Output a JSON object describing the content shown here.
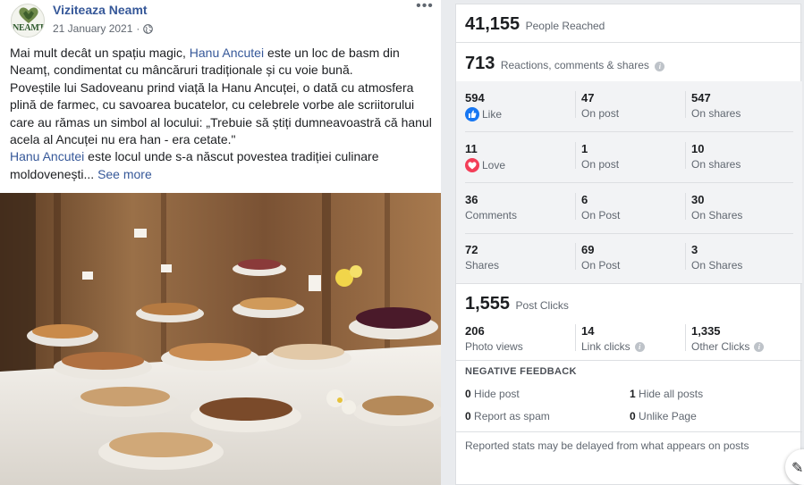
{
  "post": {
    "page_name": "Viziteaza Neamt",
    "avatar_text": "NEAMT",
    "date": "21 January 2021",
    "separator": "·",
    "text": {
      "line1_a": "Mai mult decât un spațiu magic, ",
      "line1_link": "Hanu Ancutei",
      "line1_b": " este un loc de basm din Neamț, condimentat cu mâncăruri tradiționale și cu voie bună.",
      "line2": "Poveștile lui Sadoveanu prind viață la Hanu Ancuței, o dată cu atmosfera plină de farmec, cu savoarea bucatelor, cu celebrele vorbe ale scriitorului care au rămas un simbol al locului: „Trebuie să știți dumneavoastră că hanul acela al Ancuței nu era han - era cetate.\"",
      "line3_link": "Hanu Ancutei",
      "line3_b": " este locul unde s-a născut povestea tradiției culinare moldovenești...",
      "see_more": "See more"
    }
  },
  "insights": {
    "reach": {
      "value": "41,155",
      "label": "People Reached"
    },
    "engagement": {
      "value": "713",
      "label": "Reactions, comments & shares"
    },
    "grid": [
      {
        "c1": {
          "n": "594",
          "l": "Like",
          "icon": "like-icon"
        },
        "c2": {
          "n": "47",
          "l": "On post"
        },
        "c3": {
          "n": "547",
          "l": "On shares"
        }
      },
      {
        "c1": {
          "n": "11",
          "l": "Love",
          "icon": "love-icon"
        },
        "c2": {
          "n": "1",
          "l": "On post"
        },
        "c3": {
          "n": "10",
          "l": "On shares"
        }
      },
      {
        "c1": {
          "n": "36",
          "l": "Comments"
        },
        "c2": {
          "n": "6",
          "l": "On Post"
        },
        "c3": {
          "n": "30",
          "l": "On Shares"
        }
      },
      {
        "c1": {
          "n": "72",
          "l": "Shares"
        },
        "c2": {
          "n": "69",
          "l": "On Post"
        },
        "c3": {
          "n": "3",
          "l": "On Shares"
        }
      }
    ],
    "clicks": {
      "value": "1,555",
      "label": "Post Clicks",
      "items": [
        {
          "n": "206",
          "l": "Photo views"
        },
        {
          "n": "14",
          "l": "Link clicks"
        },
        {
          "n": "1,335",
          "l": "Other Clicks"
        }
      ]
    },
    "negative": {
      "title": "NEGATIVE FEEDBACK",
      "items": [
        {
          "n": "0",
          "l": "Hide post"
        },
        {
          "n": "1",
          "l": "Hide all posts"
        },
        {
          "n": "0",
          "l": "Report as spam"
        },
        {
          "n": "0",
          "l": "Unlike Page"
        }
      ]
    },
    "footnote": "Reported stats may be delayed from what appears on posts"
  },
  "colors": {
    "link": "#365899",
    "like": "#1877f2",
    "love": "#f33e58",
    "panel_bg": "#f2f3f5"
  }
}
